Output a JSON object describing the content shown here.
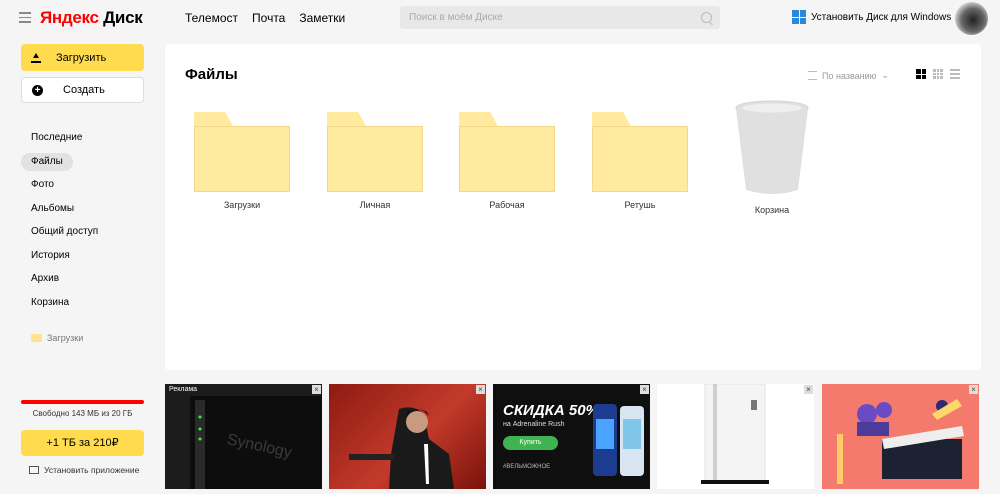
{
  "header": {
    "logo_brand": "Яндекс",
    "logo_product": "Диск",
    "nav": [
      "Телемост",
      "Почта",
      "Заметки"
    ],
    "search_placeholder": "Поиск в моём Диске",
    "install_windows": "Установить Диск для Windows"
  },
  "sidebar": {
    "upload_label": "Загрузить",
    "create_label": "Создать",
    "items": [
      {
        "label": "Последние",
        "active": false
      },
      {
        "label": "Файлы",
        "active": true
      },
      {
        "label": "Фото",
        "active": false
      },
      {
        "label": "Альбомы",
        "active": false
      },
      {
        "label": "Общий доступ",
        "active": false
      },
      {
        "label": "История",
        "active": false
      },
      {
        "label": "Архив",
        "active": false
      },
      {
        "label": "Корзина",
        "active": false
      }
    ],
    "pinned": "Загрузки",
    "storage_text": "Свободно 143 МБ из 20 ГБ",
    "buy_label": "+1 ТБ за 210₽",
    "install_app": "Установить приложение"
  },
  "main": {
    "title": "Файлы",
    "sort_label": "По названию",
    "items": [
      {
        "type": "folder",
        "label": "Загрузки"
      },
      {
        "type": "folder",
        "label": "Личная"
      },
      {
        "type": "folder",
        "label": "Рабочая"
      },
      {
        "type": "folder",
        "label": "Ретушь"
      },
      {
        "type": "trash",
        "label": "Корзина"
      }
    ]
  },
  "ads": {
    "ad_label": "Реклама",
    "promo_title": "СКИДКА 50%",
    "promo_sub": "на Adrenaline Rush",
    "promo_button": "Купить",
    "promo_tag": "#ВЕЛЬМОЖНОЕ",
    "synology_text": "Synology"
  },
  "colors": {
    "accent": "#ffdb4d",
    "storage_bar": "#ff0000",
    "folder": "#ffeaa0"
  }
}
